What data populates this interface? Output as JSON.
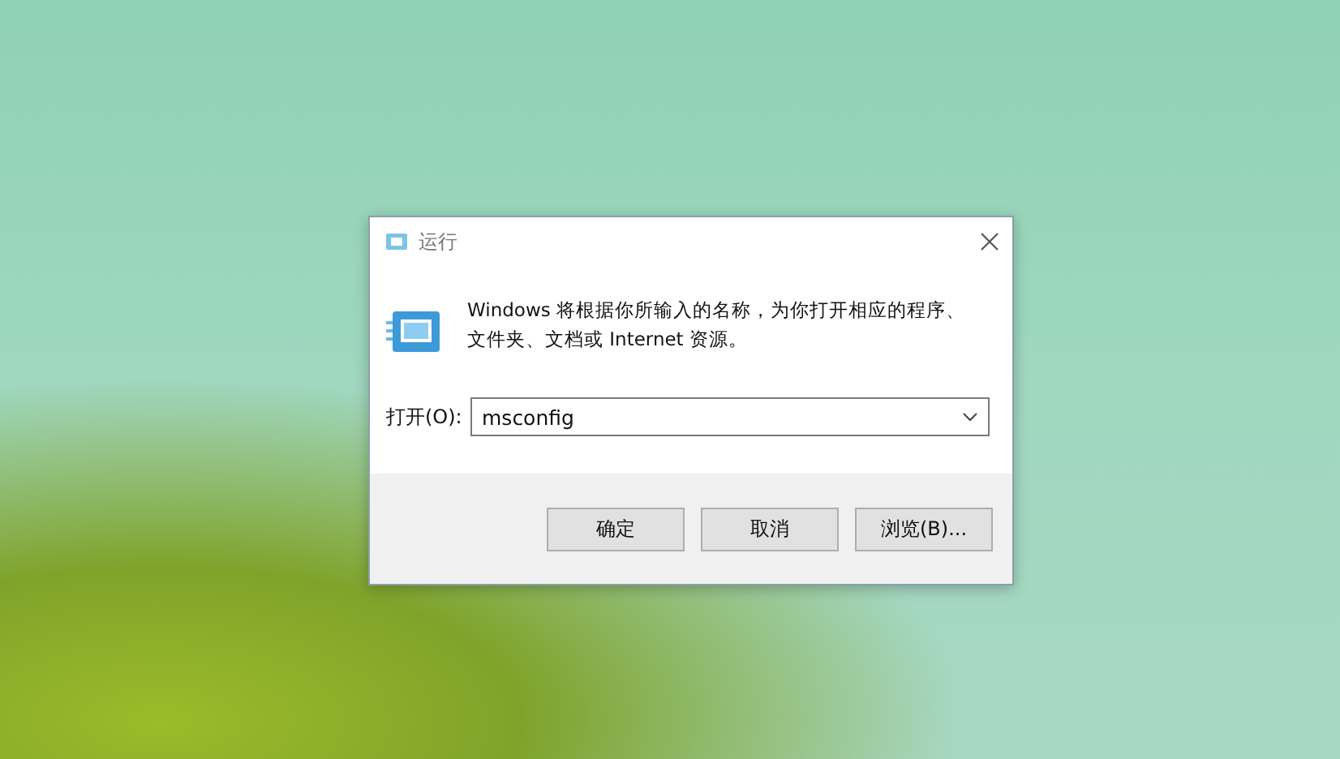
{
  "window": {
    "title": "运行"
  },
  "message_lines": [
    "Windows 将根据你所输入的名称，为你打开相应的程序、",
    "文件夹、文档或 Internet 资源。"
  ],
  "open_field": {
    "label": "打开(O):",
    "value": "msconfig"
  },
  "buttons": [
    {
      "label": "确定"
    },
    {
      "label": "取消"
    },
    {
      "label": "浏览(B)..."
    }
  ]
}
